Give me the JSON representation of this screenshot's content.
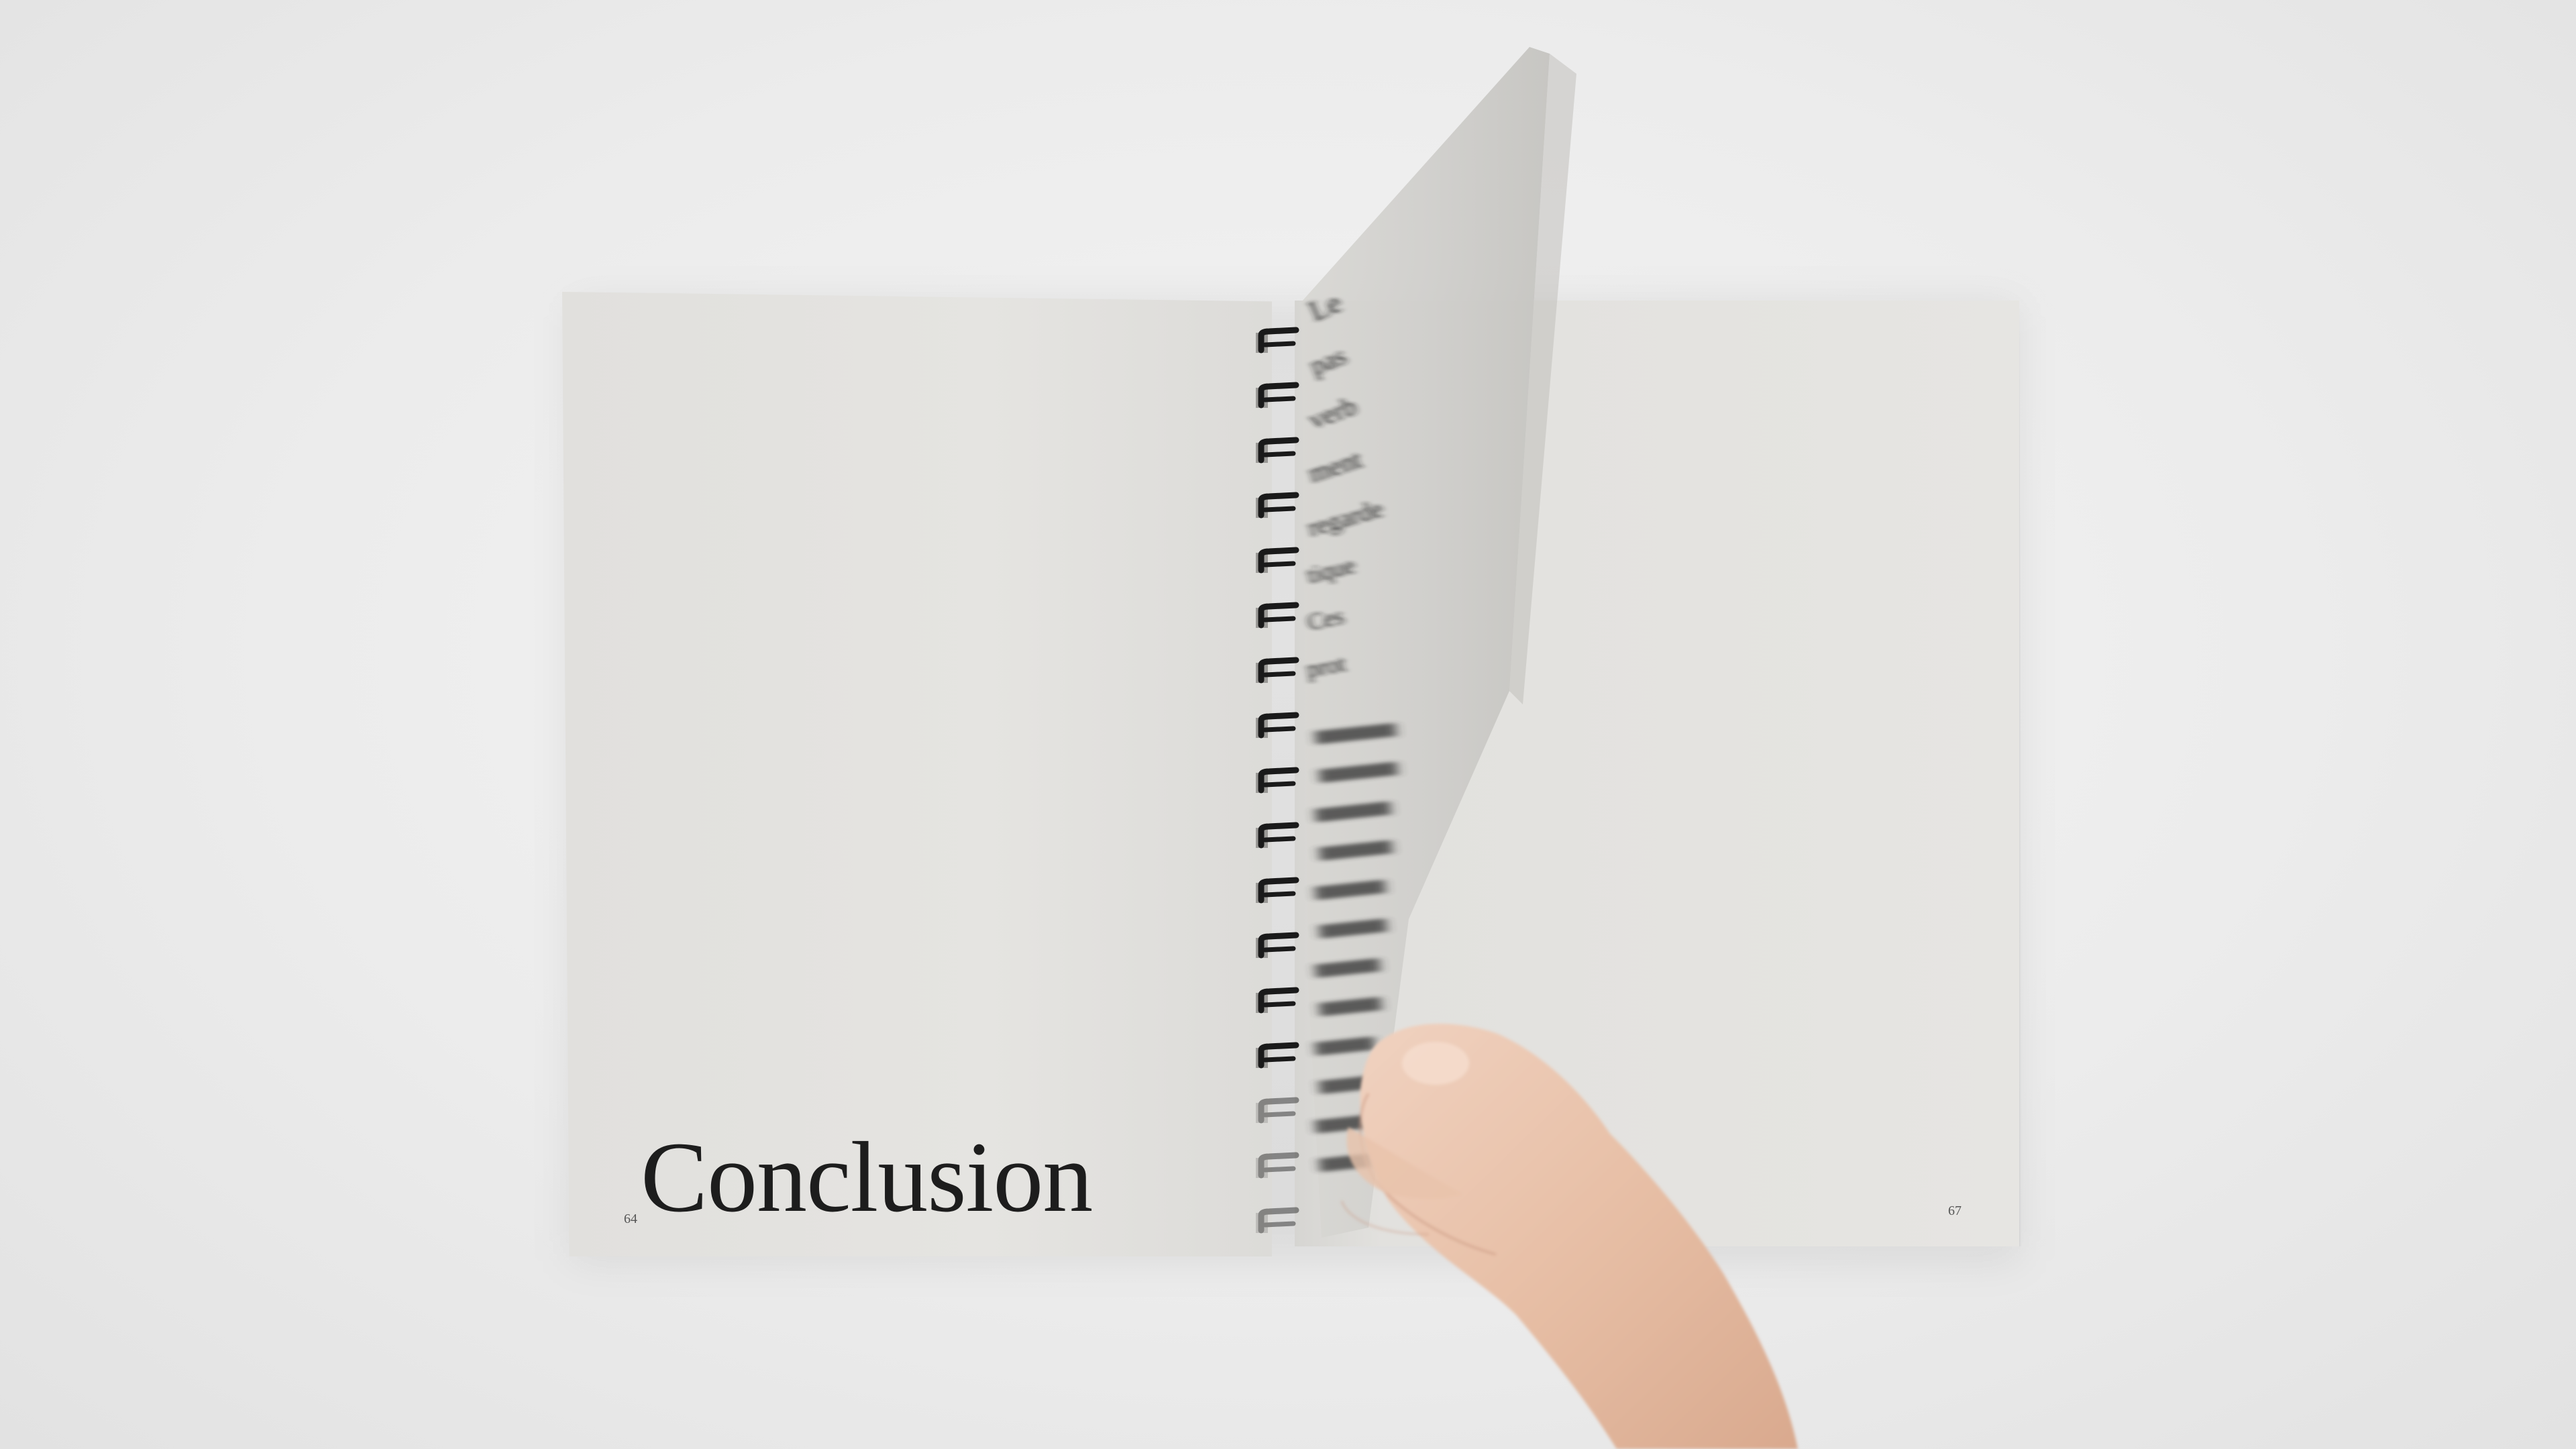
{
  "book": {
    "left_page_number": "64",
    "right_page_number": "67",
    "left_page_title": "Conclusion"
  },
  "turning_page": {
    "visible_text_fragments": [
      "Le",
      "pas",
      "verb",
      "ment",
      "regarde",
      "tique",
      "Ces",
      "prot"
    ]
  },
  "colors": {
    "background": "#ececec",
    "paper": "#e4e3e0",
    "ink": "#1d1d1d",
    "spiral": "#1a1a1a",
    "skin": "#e8c4ae"
  }
}
